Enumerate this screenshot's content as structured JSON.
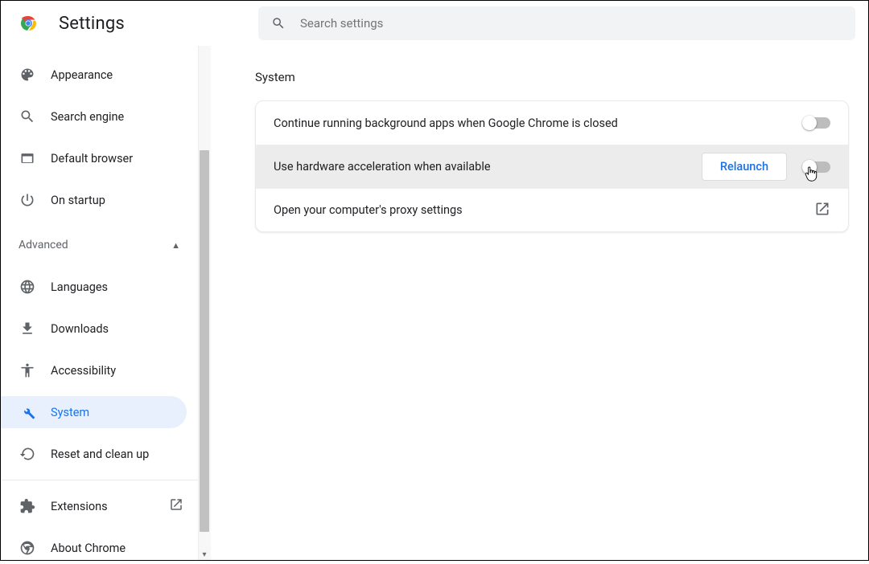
{
  "header": {
    "title": "Settings",
    "search_placeholder": "Search settings"
  },
  "sidebar": {
    "items": [
      {
        "id": "appearance",
        "label": "Appearance",
        "icon": "palette"
      },
      {
        "id": "search-engine",
        "label": "Search engine",
        "icon": "search"
      },
      {
        "id": "default-browser",
        "label": "Default browser",
        "icon": "browser-box"
      },
      {
        "id": "on-startup",
        "label": "On startup",
        "icon": "power"
      }
    ],
    "advanced_label": "Advanced",
    "advanced_items": [
      {
        "id": "languages",
        "label": "Languages",
        "icon": "globe"
      },
      {
        "id": "downloads",
        "label": "Downloads",
        "icon": "download"
      },
      {
        "id": "accessibility",
        "label": "Accessibility",
        "icon": "accessibility"
      },
      {
        "id": "system",
        "label": "System",
        "icon": "wrench",
        "active": true
      },
      {
        "id": "reset",
        "label": "Reset and clean up",
        "icon": "restore"
      }
    ],
    "footer_items": [
      {
        "id": "extensions",
        "label": "Extensions",
        "icon": "extension",
        "external": true
      },
      {
        "id": "about",
        "label": "About Chrome",
        "icon": "chrome"
      }
    ]
  },
  "main": {
    "section_title": "System",
    "rows": [
      {
        "label": "Continue running background apps when Google Chrome is closed",
        "toggle": "off"
      },
      {
        "label": "Use hardware acceleration when available",
        "toggle": "off",
        "action_label": "Relaunch",
        "highlight": true
      },
      {
        "label": "Open your computer's proxy settings",
        "external": true
      }
    ]
  }
}
